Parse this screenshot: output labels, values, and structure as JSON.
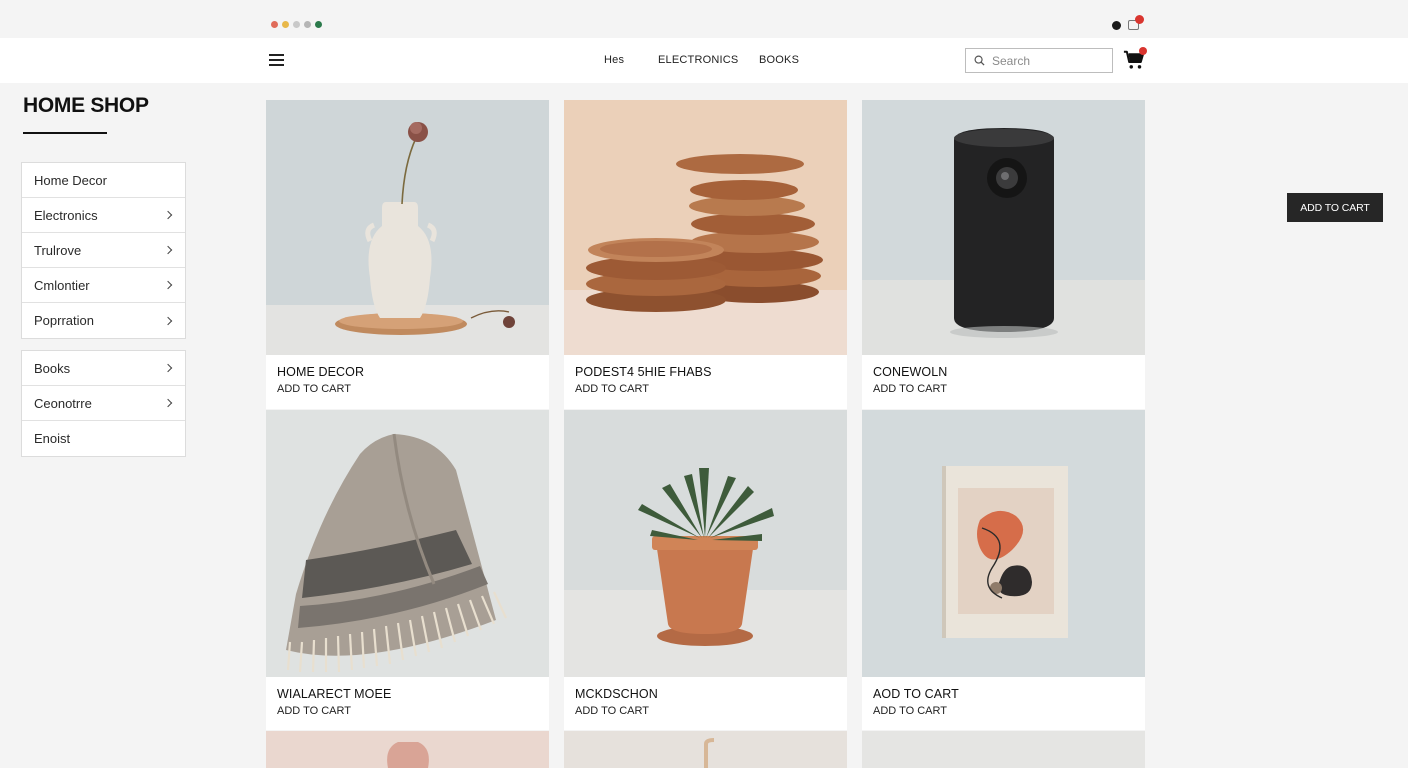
{
  "window_controls": {
    "dot_colors": [
      "#e06c5a",
      "#e8b84a",
      "#c9c9c9",
      "#b5b5b5",
      "#2b7a4b"
    ]
  },
  "colors": {
    "accent_badge": "#d9352f",
    "dark_button": "#262626"
  },
  "nav": {
    "menu_icon": "hamburger-icon",
    "links": [
      "Hes",
      "ELECTRONICS",
      "BOOKS"
    ],
    "search_placeholder": "Search",
    "search_icon": "search-icon",
    "cart_icon": "cart-icon"
  },
  "shop": {
    "title": "HOME SHOP"
  },
  "sidebar": {
    "group1": [
      {
        "label": "Home Decor",
        "chevron": false
      },
      {
        "label": "Electronics",
        "chevron": true
      },
      {
        "label": "Trulrove",
        "chevron": true
      },
      {
        "label": "Cmlontier",
        "chevron": true
      },
      {
        "label": "Poprration",
        "chevron": true
      }
    ],
    "group2": [
      {
        "label": "Books",
        "chevron": true
      },
      {
        "label": "Ceonotrre",
        "chevron": true
      },
      {
        "label": "Enoist",
        "chevron": false
      }
    ]
  },
  "products": [
    {
      "name": "HOME DECOR",
      "action": "ADD TO CART",
      "image": "vase-image"
    },
    {
      "name": "PODEST4 5HIE FHABS",
      "action": "ADD TO CART",
      "image": "wooden-coasters-image"
    },
    {
      "name": "CONEWOLN",
      "action": "ADD TO CART",
      "image": "speaker-image"
    },
    {
      "name": "WIALARECT MOEE",
      "action": "ADD TO CART",
      "image": "throw-blanket-image"
    },
    {
      "name": "MCKDSCHON",
      "action": "ADD TO CART",
      "image": "succulent-plant-image"
    },
    {
      "name": "AOD TO CART",
      "action": "ADD TO CART",
      "image": "art-book-image"
    }
  ],
  "floating_button": {
    "label": "ADD TO CART"
  }
}
